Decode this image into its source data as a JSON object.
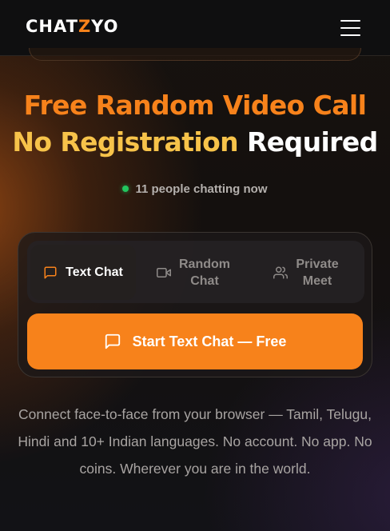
{
  "header": {
    "logo_part1": "CHAT",
    "logo_accent": "Z",
    "logo_part2": "YO",
    "menu_icon": "hamburger-menu-icon"
  },
  "hero": {
    "title_line1": "Free Random Video Call",
    "title_line2_highlight": "No Registration",
    "title_line2_rest": "Required",
    "online_text": "11 people chatting now"
  },
  "tabs": [
    {
      "label": "Text Chat",
      "icon": "message-square-icon",
      "active": true
    },
    {
      "label_line1": "Random",
      "label_line2": "Chat",
      "icon": "video-camera-icon",
      "active": false
    },
    {
      "label_line1": "Private",
      "label_line2": "Meet",
      "icon": "users-icon",
      "active": false
    }
  ],
  "cta": {
    "label": "Start Text Chat — Free",
    "icon": "message-square-icon"
  },
  "description": "Connect face-to-face from your browser — Tamil, Telugu, Hindi and 10+ Indian languages. No account. No app. No coins. Wherever you are in the world.",
  "colors": {
    "accent_orange": "#f7821b",
    "accent_yellow": "#f7c34a",
    "online_green": "#22c55e",
    "background": "#121212"
  }
}
